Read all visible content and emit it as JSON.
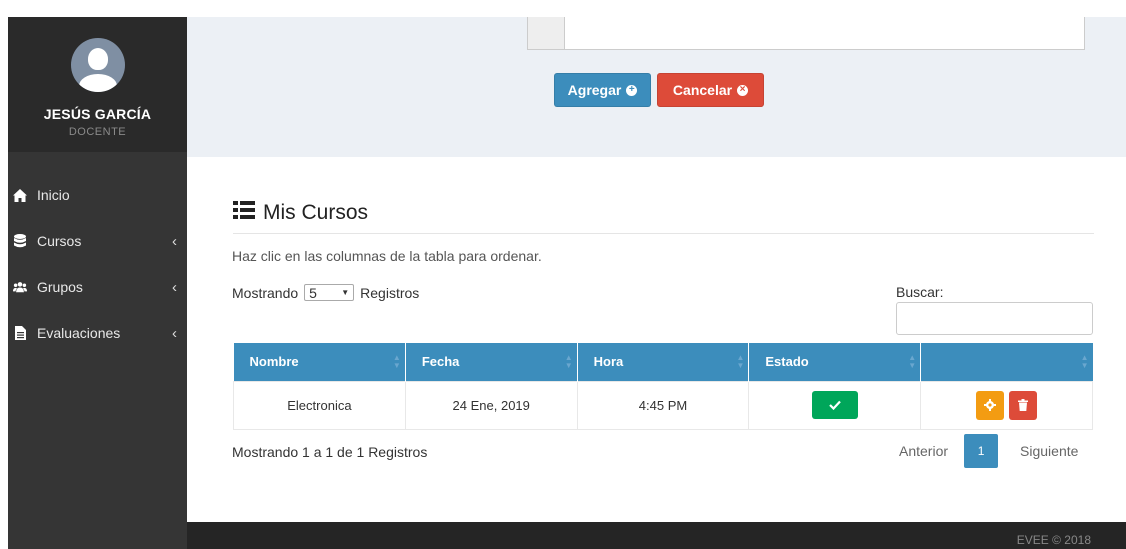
{
  "sidebar": {
    "user_name": "JESÚS GARCÍA",
    "user_role": "DOCENTE",
    "items": [
      {
        "label": "Inicio",
        "icon": "home-icon"
      },
      {
        "label": "Cursos",
        "icon": "database-icon"
      },
      {
        "label": "Grupos",
        "icon": "users-icon"
      },
      {
        "label": "Evaluaciones",
        "icon": "file-icon"
      }
    ]
  },
  "form": {
    "add_label": "Agregar",
    "cancel_label": "Cancelar"
  },
  "section": {
    "title": "Mis Cursos",
    "hint": "Haz clic en las columnas de la tabla para ordenar.",
    "show_prefix": "Mostrando",
    "show_value": "5",
    "show_suffix": "Registros",
    "search_label": "Buscar:"
  },
  "table": {
    "headers": [
      "Nombre",
      "Fecha",
      "Hora",
      "Estado",
      ""
    ],
    "rows": [
      {
        "nombre": "Electronica",
        "fecha": "24 Ene, 2019",
        "hora": "4:45 PM"
      }
    ]
  },
  "info": "Mostrando 1 a 1 de 1 Registros",
  "pagination": {
    "prev": "Anterior",
    "page": "1",
    "next": "Siguiente"
  },
  "footer": "EVEE © 2018",
  "colors": {
    "primary": "#3c8dbc",
    "danger": "#dd4b39",
    "success": "#00a65a",
    "warning": "#f39c12"
  }
}
